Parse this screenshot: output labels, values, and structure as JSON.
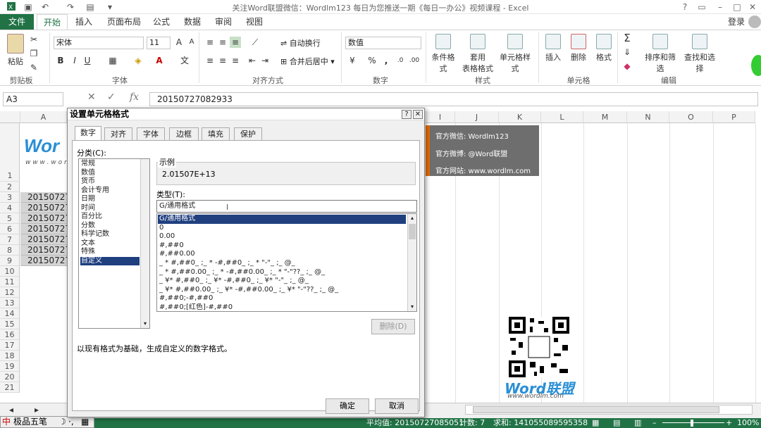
{
  "window": {
    "title": "关注Word联盟微信：Wordlm123    每日为您推送一期《每日一办公》视频课程 - Excel",
    "login": "登录",
    "help": "?"
  },
  "ribbon_tabs": [
    "文件",
    "开始",
    "插入",
    "页面布局",
    "公式",
    "数据",
    "审阅",
    "视图"
  ],
  "ribbon": {
    "clipboard": {
      "paste": "粘贴",
      "group": "剪贴板"
    },
    "font": {
      "name": "宋体",
      "size": "11",
      "bold": "B",
      "italic": "I",
      "underline": "U",
      "group": "字体"
    },
    "alignment": {
      "wrap": "自动换行",
      "merge": "合并后居中",
      "group": "对齐方式"
    },
    "number": {
      "format": "数值",
      "percent": "%",
      "comma": ",",
      "group": "数字"
    },
    "styles": {
      "conditional": "条件格式",
      "table_line1": "套用",
      "table_line2": "表格格式",
      "cell_styles": "单元格样式",
      "group": "样式"
    },
    "cells": {
      "insert": "插入",
      "delete": "删除",
      "format": "格式",
      "group": "单元格"
    },
    "editing": {
      "sort": "排序和筛选",
      "find": "查找和选择",
      "group": "编辑"
    }
  },
  "formula_bar": {
    "name_box": "A3",
    "fx": "fx",
    "value": "20150727082933"
  },
  "columns": [
    "A",
    "I",
    "J",
    "K",
    "L",
    "M",
    "N",
    "O",
    "P"
  ],
  "rows": [
    "1",
    "2",
    "3",
    "4",
    "5",
    "6",
    "7",
    "8",
    "9",
    "10",
    "11",
    "12",
    "13",
    "14",
    "15",
    "16",
    "17",
    "18",
    "19",
    "20",
    "21"
  ],
  "cellA_values": [
    "20150727",
    "20150727",
    "20150727",
    "20150727",
    "20150727",
    "20150727",
    "20150727"
  ],
  "logo_text": "Wor",
  "logo_sub": "w w w . w o r",
  "banner": {
    "wechat": "官方微信: Wordlm123",
    "weibo": "官方微博: @Word联盟",
    "site": "官方网站: www.wordlm.com"
  },
  "qr_logo": "Word联盟",
  "qr_url": "www.wordlm.com",
  "dialog": {
    "title": "设置单元格格式",
    "tabs": [
      "数字",
      "对齐",
      "字体",
      "边框",
      "填充",
      "保护"
    ],
    "category_label": "分类(C):",
    "categories": [
      "常规",
      "数值",
      "货币",
      "会计专用",
      "日期",
      "时间",
      "百分比",
      "分数",
      "科学记数",
      "文本",
      "特殊",
      "自定义"
    ],
    "sample_label": "示例",
    "sample_value": "2.01507E+13",
    "type_label": "类型(T):",
    "type_value": "G/通用格式",
    "formats": [
      "G/通用格式",
      "0",
      "0.00",
      "#,##0",
      "#,##0.00",
      "_ * #,##0_ ;_ * -#,##0_ ;_ * \"-\"_ ;_ @_",
      "_ * #,##0.00_ ;_ * -#,##0.00_ ;_ * \"-\"??_ ;_ @_",
      "_ ¥* #,##0_ ;_ ¥* -#,##0_ ;_ ¥* \"-\"_ ;_ @_",
      "_ ¥* #,##0.00_ ;_ ¥* -#,##0.00_ ;_ ¥* \"-\"??_ ;_ @_",
      "#,##0;-#,##0",
      "#,##0;[红色]-#,##0"
    ],
    "delete_button": "删除(D)",
    "description": "以现有格式为基础，生成自定义的数字格式。",
    "ok": "确定",
    "cancel": "取消"
  },
  "ime": {
    "label": "极品五笔"
  },
  "status": {
    "average": "平均值: 20150727085051",
    "count": "计数: 7",
    "sum": "求和: 141055089595358",
    "zoom": "100%"
  },
  "colors": {
    "excel_green": "#217346",
    "banner_gray": "#6e6e6e",
    "banner_accent": "#e36c09",
    "selection": "#1f3f7f"
  }
}
